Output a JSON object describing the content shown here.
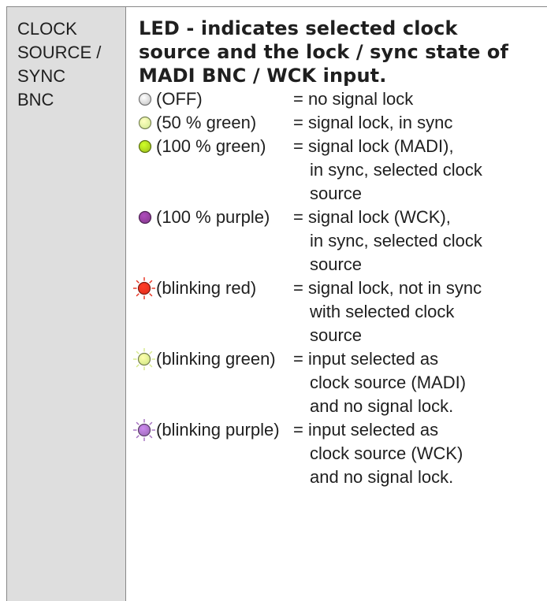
{
  "label": {
    "lines": [
      "CLOCK",
      "SOURCE /",
      "SYNC",
      "BNC"
    ]
  },
  "heading": {
    "lines": [
      "LED - indicates selected clock",
      "source and the lock / sync state of",
      "MADI BNC / WCK input."
    ]
  },
  "led_states": [
    {
      "state": "(OFF)",
      "meaning": [
        "= no signal lock"
      ],
      "icon": "led-off-icon",
      "color": "#cfcfcf",
      "blink": false
    },
    {
      "state": "(50 % green)",
      "meaning": [
        "= signal lock, in sync"
      ],
      "icon": "led-green-half-icon",
      "color": "#d9ec9a",
      "blink": false
    },
    {
      "state": "(100 % green)",
      "meaning": [
        "= signal lock (MADI),",
        "in sync, selected clock",
        "source"
      ],
      "icon": "led-green-full-icon",
      "color": "#a6cc1f",
      "blink": false
    },
    {
      "state": "(100 % purple)",
      "meaning": [
        "= signal lock (WCK),",
        "in sync, selected clock",
        "source"
      ],
      "icon": "led-purple-full-icon",
      "color": "#8c3d96",
      "blink": false
    },
    {
      "state": "(blinking red)",
      "meaning": [
        "= signal lock, not in sync",
        "with selected clock",
        "source"
      ],
      "icon": "led-red-blinking-icon",
      "color": "#e8301e",
      "blink": true
    },
    {
      "state": "(blinking green)",
      "meaning": [
        "= input selected as",
        "clock source (MADI)",
        "and no signal lock."
      ],
      "icon": "led-green-blinking-icon",
      "color": "#d6ea8a",
      "blink": true
    },
    {
      "state": "(blinking purple)",
      "meaning": [
        "= input selected as",
        "clock source (WCK)",
        "and no signal lock."
      ],
      "icon": "led-purple-blinking-icon",
      "color": "#a46fc0",
      "blink": true
    }
  ]
}
